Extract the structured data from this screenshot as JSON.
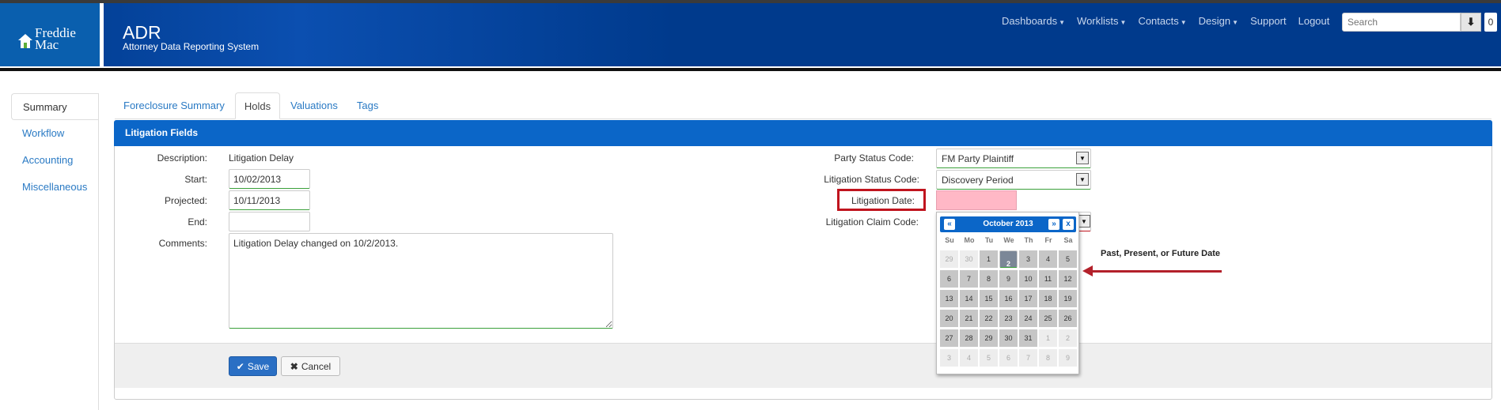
{
  "header": {
    "logo_line1": "Freddie",
    "logo_line2": "Mac",
    "title": "ADR",
    "subtitle": "Attorney Data Reporting System",
    "nav": [
      {
        "label": "Dashboards",
        "dropdown": true
      },
      {
        "label": "Worklists",
        "dropdown": true
      },
      {
        "label": "Contacts",
        "dropdown": true
      },
      {
        "label": "Design",
        "dropdown": true
      },
      {
        "label": "Support",
        "dropdown": false
      },
      {
        "label": "Logout",
        "dropdown": false
      }
    ],
    "search_placeholder": "Search",
    "badge_count": "0"
  },
  "sidebar": {
    "items": [
      {
        "label": "Summary",
        "active": true
      },
      {
        "label": "Workflow",
        "active": false
      },
      {
        "label": "Accounting",
        "active": false
      },
      {
        "label": "Miscellaneous",
        "active": false
      }
    ]
  },
  "tabs": [
    {
      "label": "Foreclosure Summary",
      "active": false
    },
    {
      "label": "Holds",
      "active": true
    },
    {
      "label": "Valuations",
      "active": false
    },
    {
      "label": "Tags",
      "active": false
    }
  ],
  "panel": {
    "title": "Litigation Fields",
    "left": {
      "description_label": "Description:",
      "description_value": "Litigation Delay",
      "start_label": "Start:",
      "start_value": "10/02/2013",
      "projected_label": "Projected:",
      "projected_value": "10/11/2013",
      "end_label": "End:",
      "end_value": "",
      "comments_label": "Comments:",
      "comments_value": "Litigation Delay changed on 10/2/2013."
    },
    "right": {
      "party_status_label": "Party Status Code:",
      "party_status_value": "FM Party Plaintiff",
      "litigation_status_label": "Litigation Status Code:",
      "litigation_status_value": "Discovery Period",
      "litigation_date_label": "Litigation Date:",
      "litigation_date_value": "",
      "litigation_claim_label": "Litigation Claim Code:"
    },
    "save_label": "Save",
    "cancel_label": "Cancel"
  },
  "datepicker": {
    "title": "October 2013",
    "prev": "«",
    "next": "»",
    "close": "x",
    "dow": [
      "Su",
      "Mo",
      "Tu",
      "We",
      "Th",
      "Fr",
      "Sa"
    ],
    "weeks": [
      [
        [
          "29",
          "oth"
        ],
        [
          "30",
          "oth"
        ],
        [
          "1",
          "cur"
        ],
        [
          "2",
          "sel"
        ],
        [
          "3",
          "cur"
        ],
        [
          "4",
          "cur"
        ],
        [
          "5",
          "cur"
        ]
      ],
      [
        [
          "6",
          "cur"
        ],
        [
          "7",
          "cur"
        ],
        [
          "8",
          "cur"
        ],
        [
          "9",
          "cur"
        ],
        [
          "10",
          "cur"
        ],
        [
          "11",
          "cur"
        ],
        [
          "12",
          "cur"
        ]
      ],
      [
        [
          "13",
          "cur"
        ],
        [
          "14",
          "cur"
        ],
        [
          "15",
          "cur"
        ],
        [
          "16",
          "cur"
        ],
        [
          "17",
          "cur"
        ],
        [
          "18",
          "cur"
        ],
        [
          "19",
          "cur"
        ]
      ],
      [
        [
          "20",
          "cur"
        ],
        [
          "21",
          "cur"
        ],
        [
          "22",
          "cur"
        ],
        [
          "23",
          "cur"
        ],
        [
          "24",
          "cur"
        ],
        [
          "25",
          "cur"
        ],
        [
          "26",
          "cur"
        ]
      ],
      [
        [
          "27",
          "cur"
        ],
        [
          "28",
          "cur"
        ],
        [
          "29",
          "cur"
        ],
        [
          "30",
          "cur"
        ],
        [
          "31",
          "cur"
        ],
        [
          "1",
          "oth"
        ],
        [
          "2",
          "oth"
        ]
      ],
      [
        [
          "3",
          "oth"
        ],
        [
          "4",
          "oth"
        ],
        [
          "5",
          "oth"
        ],
        [
          "6",
          "oth"
        ],
        [
          "7",
          "oth"
        ],
        [
          "8",
          "oth"
        ],
        [
          "9",
          "oth"
        ]
      ]
    ]
  },
  "annotation": {
    "text": "Past, Present, or Future Date"
  },
  "colors": {
    "header_blue": "#003a8c",
    "panel_blue": "#0b66c8",
    "link_blue": "#2a7ac4",
    "highlight_red": "#c0141e",
    "date_field_pink": "#ffb8c6"
  }
}
